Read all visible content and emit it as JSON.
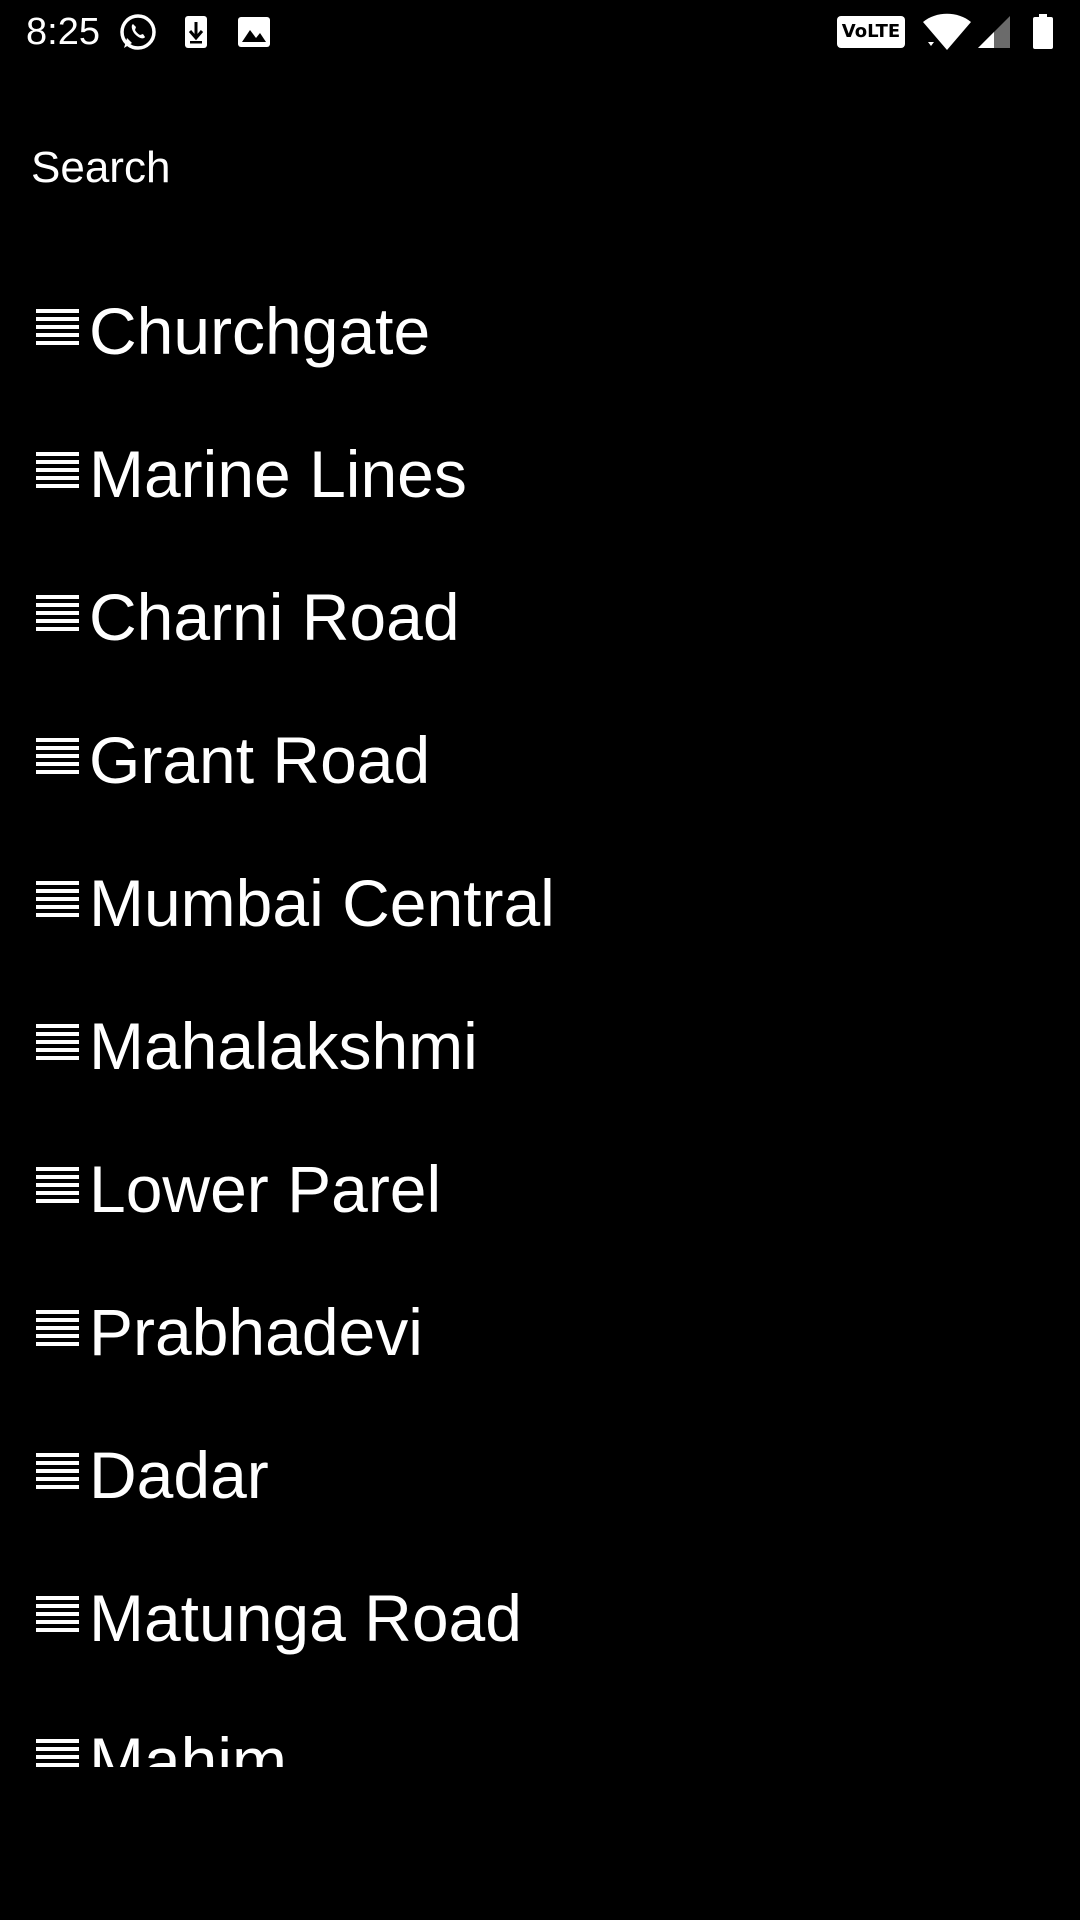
{
  "status_bar": {
    "time": "8:25",
    "left_icons": [
      "whatsapp-icon",
      "download-icon",
      "image-icon"
    ],
    "right_icons": [
      "volte-icon",
      "wifi-icon",
      "signal-icon",
      "battery-icon"
    ],
    "volte_label": "VoLTE"
  },
  "header": {
    "title": "Search"
  },
  "stations": [
    {
      "label": "Churchgate"
    },
    {
      "label": "Marine Lines"
    },
    {
      "label": "Charni Road"
    },
    {
      "label": "Grant Road"
    },
    {
      "label": "Mumbai Central"
    },
    {
      "label": "Mahalakshmi"
    },
    {
      "label": "Lower Parel"
    },
    {
      "label": "Prabhadevi"
    },
    {
      "label": "Dadar"
    },
    {
      "label": "Matunga Road"
    },
    {
      "label": "Mahim"
    }
  ],
  "colors": {
    "background": "#000000",
    "text": "#ffffff"
  }
}
